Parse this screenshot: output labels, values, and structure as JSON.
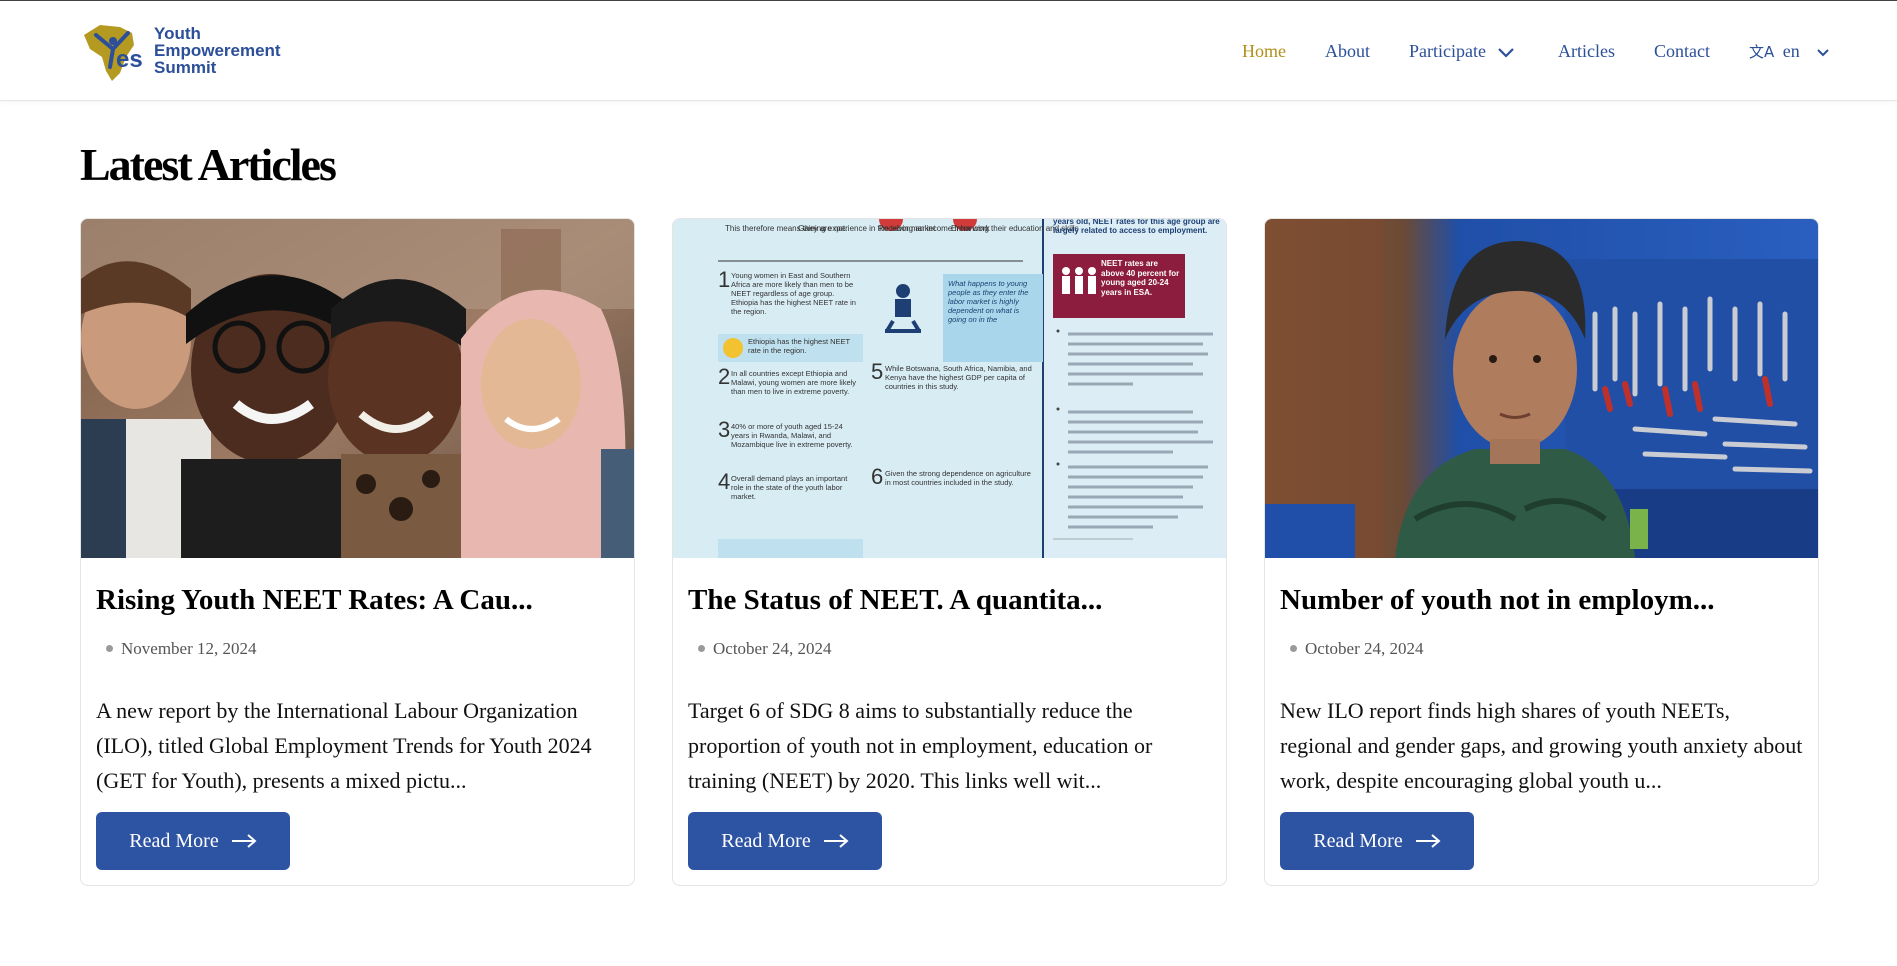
{
  "brand": {
    "name_lines": [
      "Youth",
      "Empowerement",
      "Summit"
    ],
    "logo_letters": "YES",
    "colors": {
      "blue": "#2c4f9a",
      "gold": "#b08f1a"
    }
  },
  "nav": {
    "items": [
      {
        "label": "Home",
        "active": true
      },
      {
        "label": "About"
      },
      {
        "label": "Participate",
        "dropdown": true
      },
      {
        "label": "Articles"
      },
      {
        "label": "Contact"
      }
    ],
    "language": {
      "icon": "translate-icon",
      "value": "en"
    }
  },
  "page": {
    "title": "Latest Articles"
  },
  "articles": [
    {
      "title": "Rising Youth NEET Rates: A Cau...",
      "date": "November 12, 2024",
      "excerpt": "A new report by the International Labour Organization (ILO), titled Global Employment Trends for Youth 2024 (GET for Youth), presents a mixed pictu...",
      "button": "Read More",
      "image": "group-of-young-people-photo"
    },
    {
      "title": "The Status of NEET. A quantita...",
      "date": "October 24, 2024",
      "excerpt": "Target 6 of SDG 8 aims to substantially reduce the proportion of youth not in employment, education or training (NEET) by 2020. This links well wit...",
      "button": "Read More",
      "image": "neet-infographic",
      "infographic": {
        "top_labels": [
          "This therefore means they are not:",
          "Gaining experience in the labor market",
          "Receiving an income from work",
          "Enhancing their education and skills"
        ],
        "points": [
          {
            "n": "1",
            "text": "Young women in East and Southern Africa are more likely than men to be NEET regardless of age group. Ethiopia has the highest NEET rate in the region."
          },
          {
            "n": "2",
            "text": "In all countries except Ethiopia and Malawi, young women are more likely than men to live in extreme poverty."
          },
          {
            "n": "3",
            "text": "40% or more of youth aged 15-24 years in Rwanda, Malawi, and Mozambique live in extreme poverty."
          },
          {
            "n": "4",
            "text": "Overall demand plays an important role in the state of the youth labor market."
          },
          {
            "n": "5",
            "text": "While Botswana, South Africa, Namibia, and Kenya have the highest GDP per capita of countries in this study."
          },
          {
            "n": "6",
            "text": "Given the strong dependence on agriculture in most countries included in the study."
          }
        ],
        "callout": "Ethiopia has the highest NEET rate in the region.",
        "quote": "What happens to young people as they enter the labor market is highly dependent on what is going on in the",
        "badge": "NEET rates are above 40 percent for young aged 20-24 years in ESA.",
        "right_heading": "years old, NEET rates for this age group are largely related to access to employment."
      }
    },
    {
      "title": "Number of youth not in employm...",
      "date": "October 24, 2024",
      "excerpt": "New ILO report finds high shares of youth NEETs, regional and gender gaps, and growing youth anxiety about work, despite encouraging global youth u...",
      "button": "Read More",
      "image": "young-mechanic-workshop-photo"
    }
  ]
}
